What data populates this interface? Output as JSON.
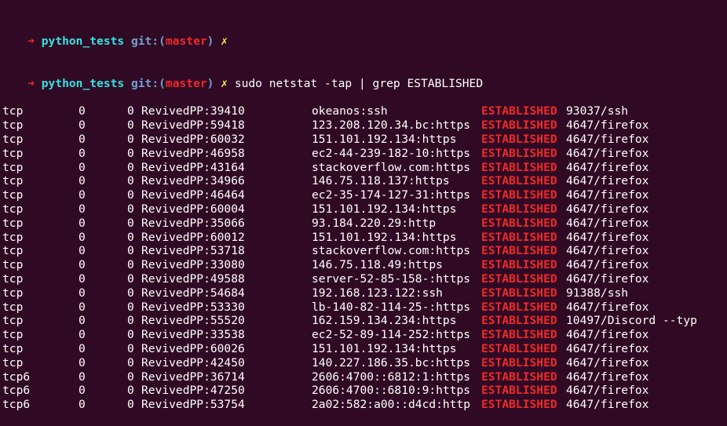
{
  "prompt_partial": {
    "arrow": "➜",
    "dir": "python_tests",
    "git_label": "git:(",
    "branch": "master",
    "git_close": ")",
    "dirty": "✗"
  },
  "prompt": {
    "arrow": "➜",
    "dir": "python_tests",
    "git_label": "git:(",
    "branch": "master",
    "git_close": ")",
    "dirty": "✗",
    "command": "sudo netstat -tap | grep ESTABLISHED"
  },
  "connections": [
    {
      "proto": "tcp",
      "recvq": "0",
      "sendq": "0",
      "local": "RevivedPP:39410",
      "foreign": "okeanos:ssh",
      "state": "ESTABLISHED",
      "highlight": true,
      "program": "93037/ssh"
    },
    {
      "proto": "tcp",
      "recvq": "0",
      "sendq": "0",
      "local": "RevivedPP:59418",
      "foreign": "123.208.120.34.bc:https",
      "state": "ESTABLISHED",
      "highlight": true,
      "program": "4647/firefox"
    },
    {
      "proto": "tcp",
      "recvq": "0",
      "sendq": "0",
      "local": "RevivedPP:60032",
      "foreign": "151.101.192.134:https",
      "state": "ESTABLISHED",
      "highlight": true,
      "program": "4647/firefox"
    },
    {
      "proto": "tcp",
      "recvq": "0",
      "sendq": "0",
      "local": "RevivedPP:46958",
      "foreign": "ec2-44-239-182-10:https",
      "state": "ESTABLISHED",
      "highlight": true,
      "program": "4647/firefox"
    },
    {
      "proto": "tcp",
      "recvq": "0",
      "sendq": "0",
      "local": "RevivedPP:43164",
      "foreign": "stackoverflow.com:https",
      "state": "ESTABLISHED",
      "highlight": true,
      "program": "4647/firefox"
    },
    {
      "proto": "tcp",
      "recvq": "0",
      "sendq": "0",
      "local": "RevivedPP:34966",
      "foreign": "146.75.118.137:https",
      "state": "ESTABLISHED",
      "highlight": true,
      "program": "4647/firefox"
    },
    {
      "proto": "tcp",
      "recvq": "0",
      "sendq": "0",
      "local": "RevivedPP:46464",
      "foreign": "ec2-35-174-127-31:https",
      "state": "ESTABLISHED",
      "highlight": true,
      "program": "4647/firefox"
    },
    {
      "proto": "tcp",
      "recvq": "0",
      "sendq": "0",
      "local": "RevivedPP:60004",
      "foreign": "151.101.192.134:https",
      "state": "ESTABLISHED",
      "highlight": true,
      "program": "4647/firefox"
    },
    {
      "proto": "tcp",
      "recvq": "0",
      "sendq": "0",
      "local": "RevivedPP:35066",
      "foreign": "93.184.220.29:http",
      "state": "ESTABLISHED",
      "highlight": true,
      "program": "4647/firefox"
    },
    {
      "proto": "tcp",
      "recvq": "0",
      "sendq": "0",
      "local": "RevivedPP:60012",
      "foreign": "151.101.192.134:https",
      "state": "ESTABLISHED",
      "highlight": true,
      "program": "4647/firefox"
    },
    {
      "proto": "tcp",
      "recvq": "0",
      "sendq": "0",
      "local": "RevivedPP:53718",
      "foreign": "stackoverflow.com:https",
      "state": "ESTABLISHED",
      "highlight": true,
      "program": "4647/firefox"
    },
    {
      "proto": "tcp",
      "recvq": "0",
      "sendq": "0",
      "local": "RevivedPP:33080",
      "foreign": "146.75.118.49:https",
      "state": "ESTABLISHED",
      "highlight": true,
      "program": "4647/firefox"
    },
    {
      "proto": "tcp",
      "recvq": "0",
      "sendq": "0",
      "local": "RevivedPP:49588",
      "foreign": "server-52-85-158-:https",
      "state": "ESTABLISHED",
      "highlight": true,
      "program": "4647/firefox"
    },
    {
      "proto": "tcp",
      "recvq": "0",
      "sendq": "0",
      "local": "RevivedPP:54684",
      "foreign": "192.168.123.122:ssh",
      "state": "ESTABLISHED",
      "highlight": true,
      "program": "91388/ssh"
    },
    {
      "proto": "tcp",
      "recvq": "0",
      "sendq": "0",
      "local": "RevivedPP:53330",
      "foreign": "lb-140-82-114-25-:https",
      "state": "ESTABLISHED",
      "highlight": true,
      "program": "4647/firefox"
    },
    {
      "proto": "tcp",
      "recvq": "0",
      "sendq": "0",
      "local": "RevivedPP:55520",
      "foreign": "162.159.134.234:https",
      "state": "ESTABLISHED",
      "highlight": true,
      "program": "10497/Discord --typ"
    },
    {
      "proto": "tcp",
      "recvq": "0",
      "sendq": "0",
      "local": "RevivedPP:33538",
      "foreign": "ec2-52-89-114-252:https",
      "state": "ESTABLISHED",
      "highlight": true,
      "program": "4647/firefox"
    },
    {
      "proto": "tcp",
      "recvq": "0",
      "sendq": "0",
      "local": "RevivedPP:60026",
      "foreign": "151.101.192.134:https",
      "state": "ESTABLISHED",
      "highlight": true,
      "program": "4647/firefox"
    },
    {
      "proto": "tcp",
      "recvq": "0",
      "sendq": "0",
      "local": "RevivedPP:42450",
      "foreign": "140.227.186.35.bc:https",
      "state": "ESTABLISHED",
      "highlight": true,
      "program": "4647/firefox"
    },
    {
      "proto": "tcp6",
      "recvq": "0",
      "sendq": "0",
      "local": "RevivedPP:36714",
      "foreign": "2606:4700::6812:1:https",
      "state": "ESTABLISHED",
      "highlight": true,
      "program": "4647/firefox"
    },
    {
      "proto": "tcp6",
      "recvq": "0",
      "sendq": "0",
      "local": "RevivedPP:47250",
      "foreign": "2606:4700::6810:9:https",
      "state": "ESTABLISHED",
      "highlight": true,
      "program": "4647/firefox"
    },
    {
      "proto": "tcp6",
      "recvq": "0",
      "sendq": "0",
      "local": "RevivedPP:53754",
      "foreign": "2a02:582:a00::d4cd:http",
      "state": "ESTABLISHED",
      "highlight": true,
      "program": "4647/firefox"
    }
  ],
  "colors": {
    "background": "#300a24",
    "text": "#ffffff",
    "state_highlight": "#ef2929",
    "prompt_dir": "#34e2e2",
    "prompt_git": "#729fcf",
    "prompt_branch": "#ef2929",
    "prompt_dirty": "#fce94f"
  }
}
